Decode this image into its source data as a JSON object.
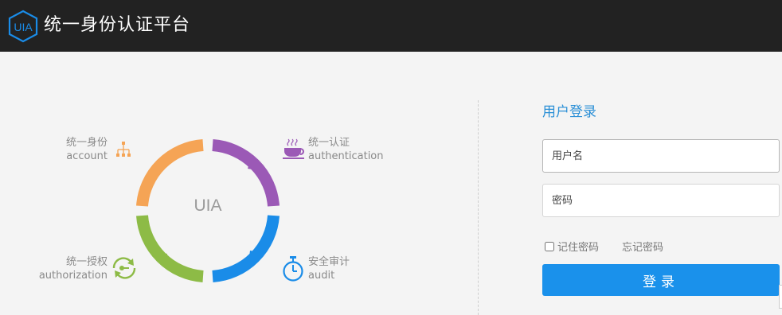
{
  "header": {
    "logo_text": "UIA",
    "app_title": "统一身份认证平台"
  },
  "ring": {
    "center_text": "UIA",
    "colors": {
      "account": "#f5a455",
      "authentication": "#9b59b6",
      "audit": "#1a8ce8",
      "authorization": "#8dbb46"
    }
  },
  "features": {
    "account": {
      "title": "统一身份",
      "subtitle": "account",
      "icon": "org-chart-icon"
    },
    "authentication": {
      "title": "统一认证",
      "subtitle": "authentication",
      "icon": "coffee-cup-icon"
    },
    "authorization": {
      "title": "统一授权",
      "subtitle": "authorization",
      "icon": "key-rotate-icon"
    },
    "audit": {
      "title": "安全审计",
      "subtitle": "audit",
      "icon": "stopwatch-icon"
    }
  },
  "login": {
    "title": "用户登录",
    "username_placeholder": "用户名",
    "password_placeholder": "密码",
    "remember_label": "记住密码",
    "forgot_label": "忘记密码",
    "submit_label": "登录",
    "accent": "#1a91eb"
  }
}
